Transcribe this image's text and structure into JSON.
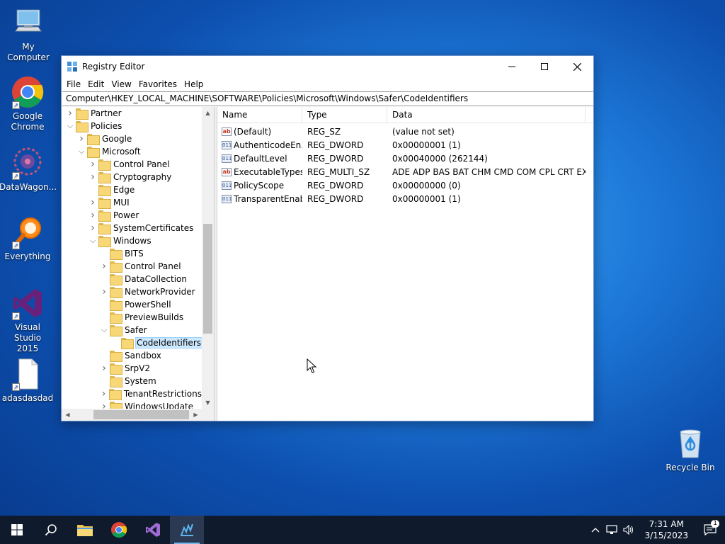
{
  "desktop": {
    "icons": [
      {
        "label": "My Computer"
      },
      {
        "label": "Google Chrome"
      },
      {
        "label": "DataWagon..."
      },
      {
        "label": "Everything"
      },
      {
        "label": "Visual Studio 2015"
      },
      {
        "label": "adasdasdad"
      },
      {
        "label": "Recycle Bin"
      }
    ]
  },
  "window": {
    "title": "Registry Editor",
    "menu": [
      "File",
      "Edit",
      "View",
      "Favorites",
      "Help"
    ],
    "address": "Computer\\HKEY_LOCAL_MACHINE\\SOFTWARE\\Policies\\Microsoft\\Windows\\Safer\\CodeIdentifiers",
    "tree": [
      {
        "label": "Partner",
        "depth": 1,
        "expander": "closed"
      },
      {
        "label": "Policies",
        "depth": 1,
        "expander": "open"
      },
      {
        "label": "Google",
        "depth": 2,
        "expander": "closed"
      },
      {
        "label": "Microsoft",
        "depth": 2,
        "expander": "open"
      },
      {
        "label": "Control Panel",
        "depth": 3,
        "expander": "closed"
      },
      {
        "label": "Cryptography",
        "depth": 3,
        "expander": "closed"
      },
      {
        "label": "Edge",
        "depth": 3,
        "expander": "none"
      },
      {
        "label": "MUI",
        "depth": 3,
        "expander": "closed"
      },
      {
        "label": "Power",
        "depth": 3,
        "expander": "closed"
      },
      {
        "label": "SystemCertificates",
        "depth": 3,
        "expander": "closed"
      },
      {
        "label": "Windows",
        "depth": 3,
        "expander": "open"
      },
      {
        "label": "BITS",
        "depth": 4,
        "expander": "none"
      },
      {
        "label": "Control Panel",
        "depth": 4,
        "expander": "closed"
      },
      {
        "label": "DataCollection",
        "depth": 4,
        "expander": "none"
      },
      {
        "label": "NetworkProvider",
        "depth": 4,
        "expander": "closed"
      },
      {
        "label": "PowerShell",
        "depth": 4,
        "expander": "none"
      },
      {
        "label": "PreviewBuilds",
        "depth": 4,
        "expander": "none"
      },
      {
        "label": "Safer",
        "depth": 4,
        "expander": "open"
      },
      {
        "label": "CodeIdentifiers",
        "depth": 5,
        "expander": "none",
        "selected": true
      },
      {
        "label": "Sandbox",
        "depth": 4,
        "expander": "none"
      },
      {
        "label": "SrpV2",
        "depth": 4,
        "expander": "closed"
      },
      {
        "label": "System",
        "depth": 4,
        "expander": "none"
      },
      {
        "label": "TenantRestrictions",
        "depth": 4,
        "expander": "closed"
      },
      {
        "label": "WindowsUpdate",
        "depth": 4,
        "expander": "closed"
      }
    ],
    "columns": {
      "name": "Name",
      "type": "Type",
      "data": "Data"
    },
    "values": [
      {
        "icon": "string-value-icon",
        "name": "(Default)",
        "type": "REG_SZ",
        "data": "(value not set)"
      },
      {
        "icon": "dword-value-icon",
        "name": "AuthenticodeEn...",
        "type": "REG_DWORD",
        "data": "0x00000001 (1)"
      },
      {
        "icon": "dword-value-icon",
        "name": "DefaultLevel",
        "type": "REG_DWORD",
        "data": "0x00040000 (262144)"
      },
      {
        "icon": "string-value-icon",
        "name": "ExecutableTypes",
        "type": "REG_MULTI_SZ",
        "data": "ADE ADP BAS BAT CHM CMD COM CPL CRT EXE ..."
      },
      {
        "icon": "dword-value-icon",
        "name": "PolicyScope",
        "type": "REG_DWORD",
        "data": "0x00000000 (0)"
      },
      {
        "icon": "dword-value-icon",
        "name": "TransparentEnab...",
        "type": "REG_DWORD",
        "data": "0x00000001 (1)"
      }
    ]
  },
  "taskbar": {
    "time": "7:31 AM",
    "date": "3/15/2023",
    "notification_count": "1"
  },
  "colors": {
    "accent": "#76b9ed",
    "selection": "#cce8ff"
  }
}
